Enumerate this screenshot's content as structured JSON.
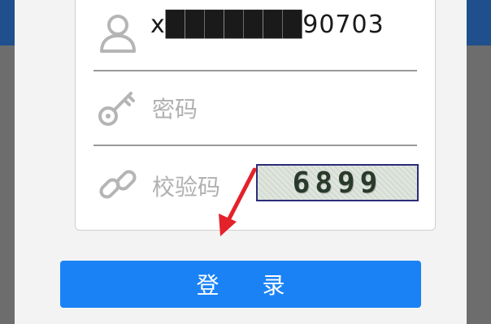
{
  "login_form": {
    "username_value": "x███████90703",
    "username_visible_suffix": "0703",
    "password_placeholder": "密码",
    "captcha_placeholder": "校验码",
    "captcha_code": "6899",
    "login_button_label": "登 录"
  },
  "icons": {
    "username": "user-icon",
    "password": "key-icon",
    "captcha": "link-icon",
    "annotation": "red-arrow-icon"
  },
  "colors": {
    "header": "#1f4f8c",
    "button": "#1a82f5",
    "annotation_arrow": "#e3222a"
  }
}
